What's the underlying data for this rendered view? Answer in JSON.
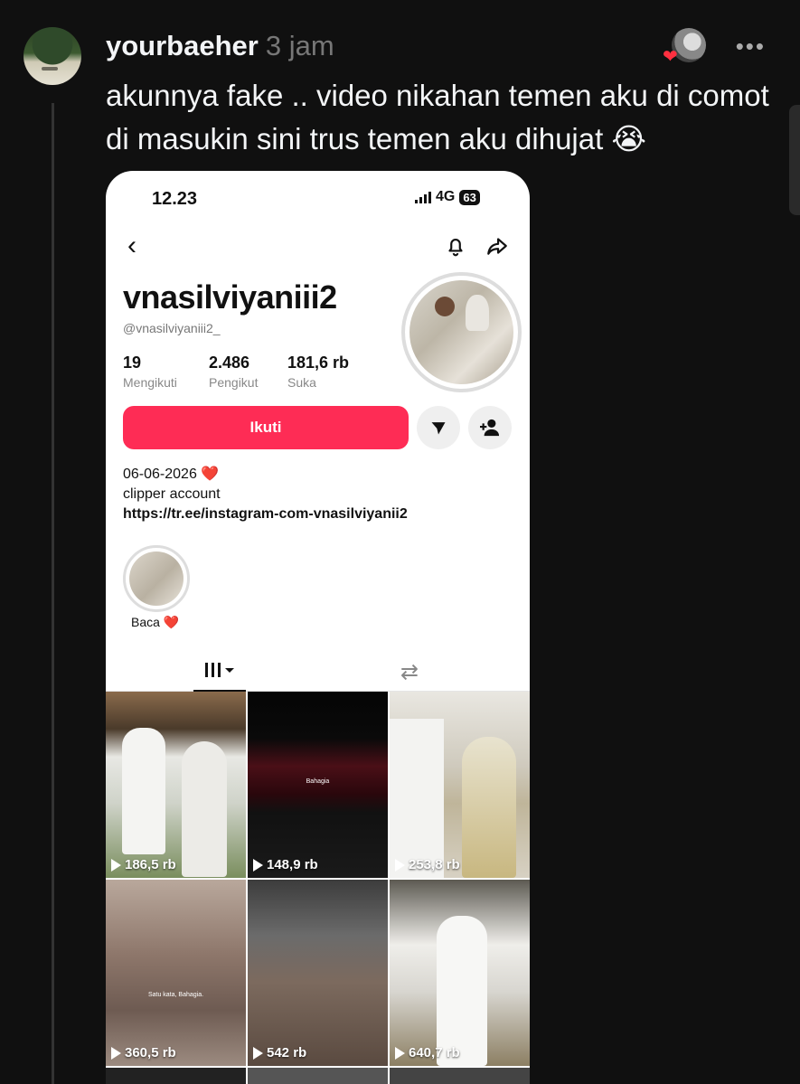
{
  "post": {
    "username": "yourbaeher",
    "time": "3 jam",
    "more": "•••",
    "caption": "akunnya fake .. video nikahan temen aku di comot di masukin sini trus temen aku dihujat 😭"
  },
  "screenshot": {
    "status_bar": {
      "time": "12.23",
      "network": "4G",
      "battery": "63"
    },
    "profile": {
      "display_name": "vnasilviyaniii2",
      "handle": "@vnasilviyaniii2_",
      "stats": [
        {
          "value": "19",
          "label": "Mengikuti"
        },
        {
          "value": "2.486",
          "label": "Pengikut"
        },
        {
          "value": "181,6 rb",
          "label": "Suka"
        }
      ],
      "follow_label": "Ikuti",
      "bio": {
        "line1": "06-06-2026 ❤️",
        "line2": "clipper account",
        "link": "https://tr.ee/instagram-com-vnasilviyanii2"
      },
      "highlight_label": "Baca ❤️"
    },
    "videos": [
      {
        "views": "186,5 rb"
      },
      {
        "views": "148,9 rb",
        "overlay": "Bahagia"
      },
      {
        "views": "253,8 rb"
      },
      {
        "views": "360,5 rb",
        "overlay": "Satu kata, Bahagia."
      },
      {
        "views": "542 rb"
      },
      {
        "views": "640,7 rb"
      }
    ]
  },
  "colors": {
    "accent": "#fe2c55",
    "background": "#101010"
  }
}
